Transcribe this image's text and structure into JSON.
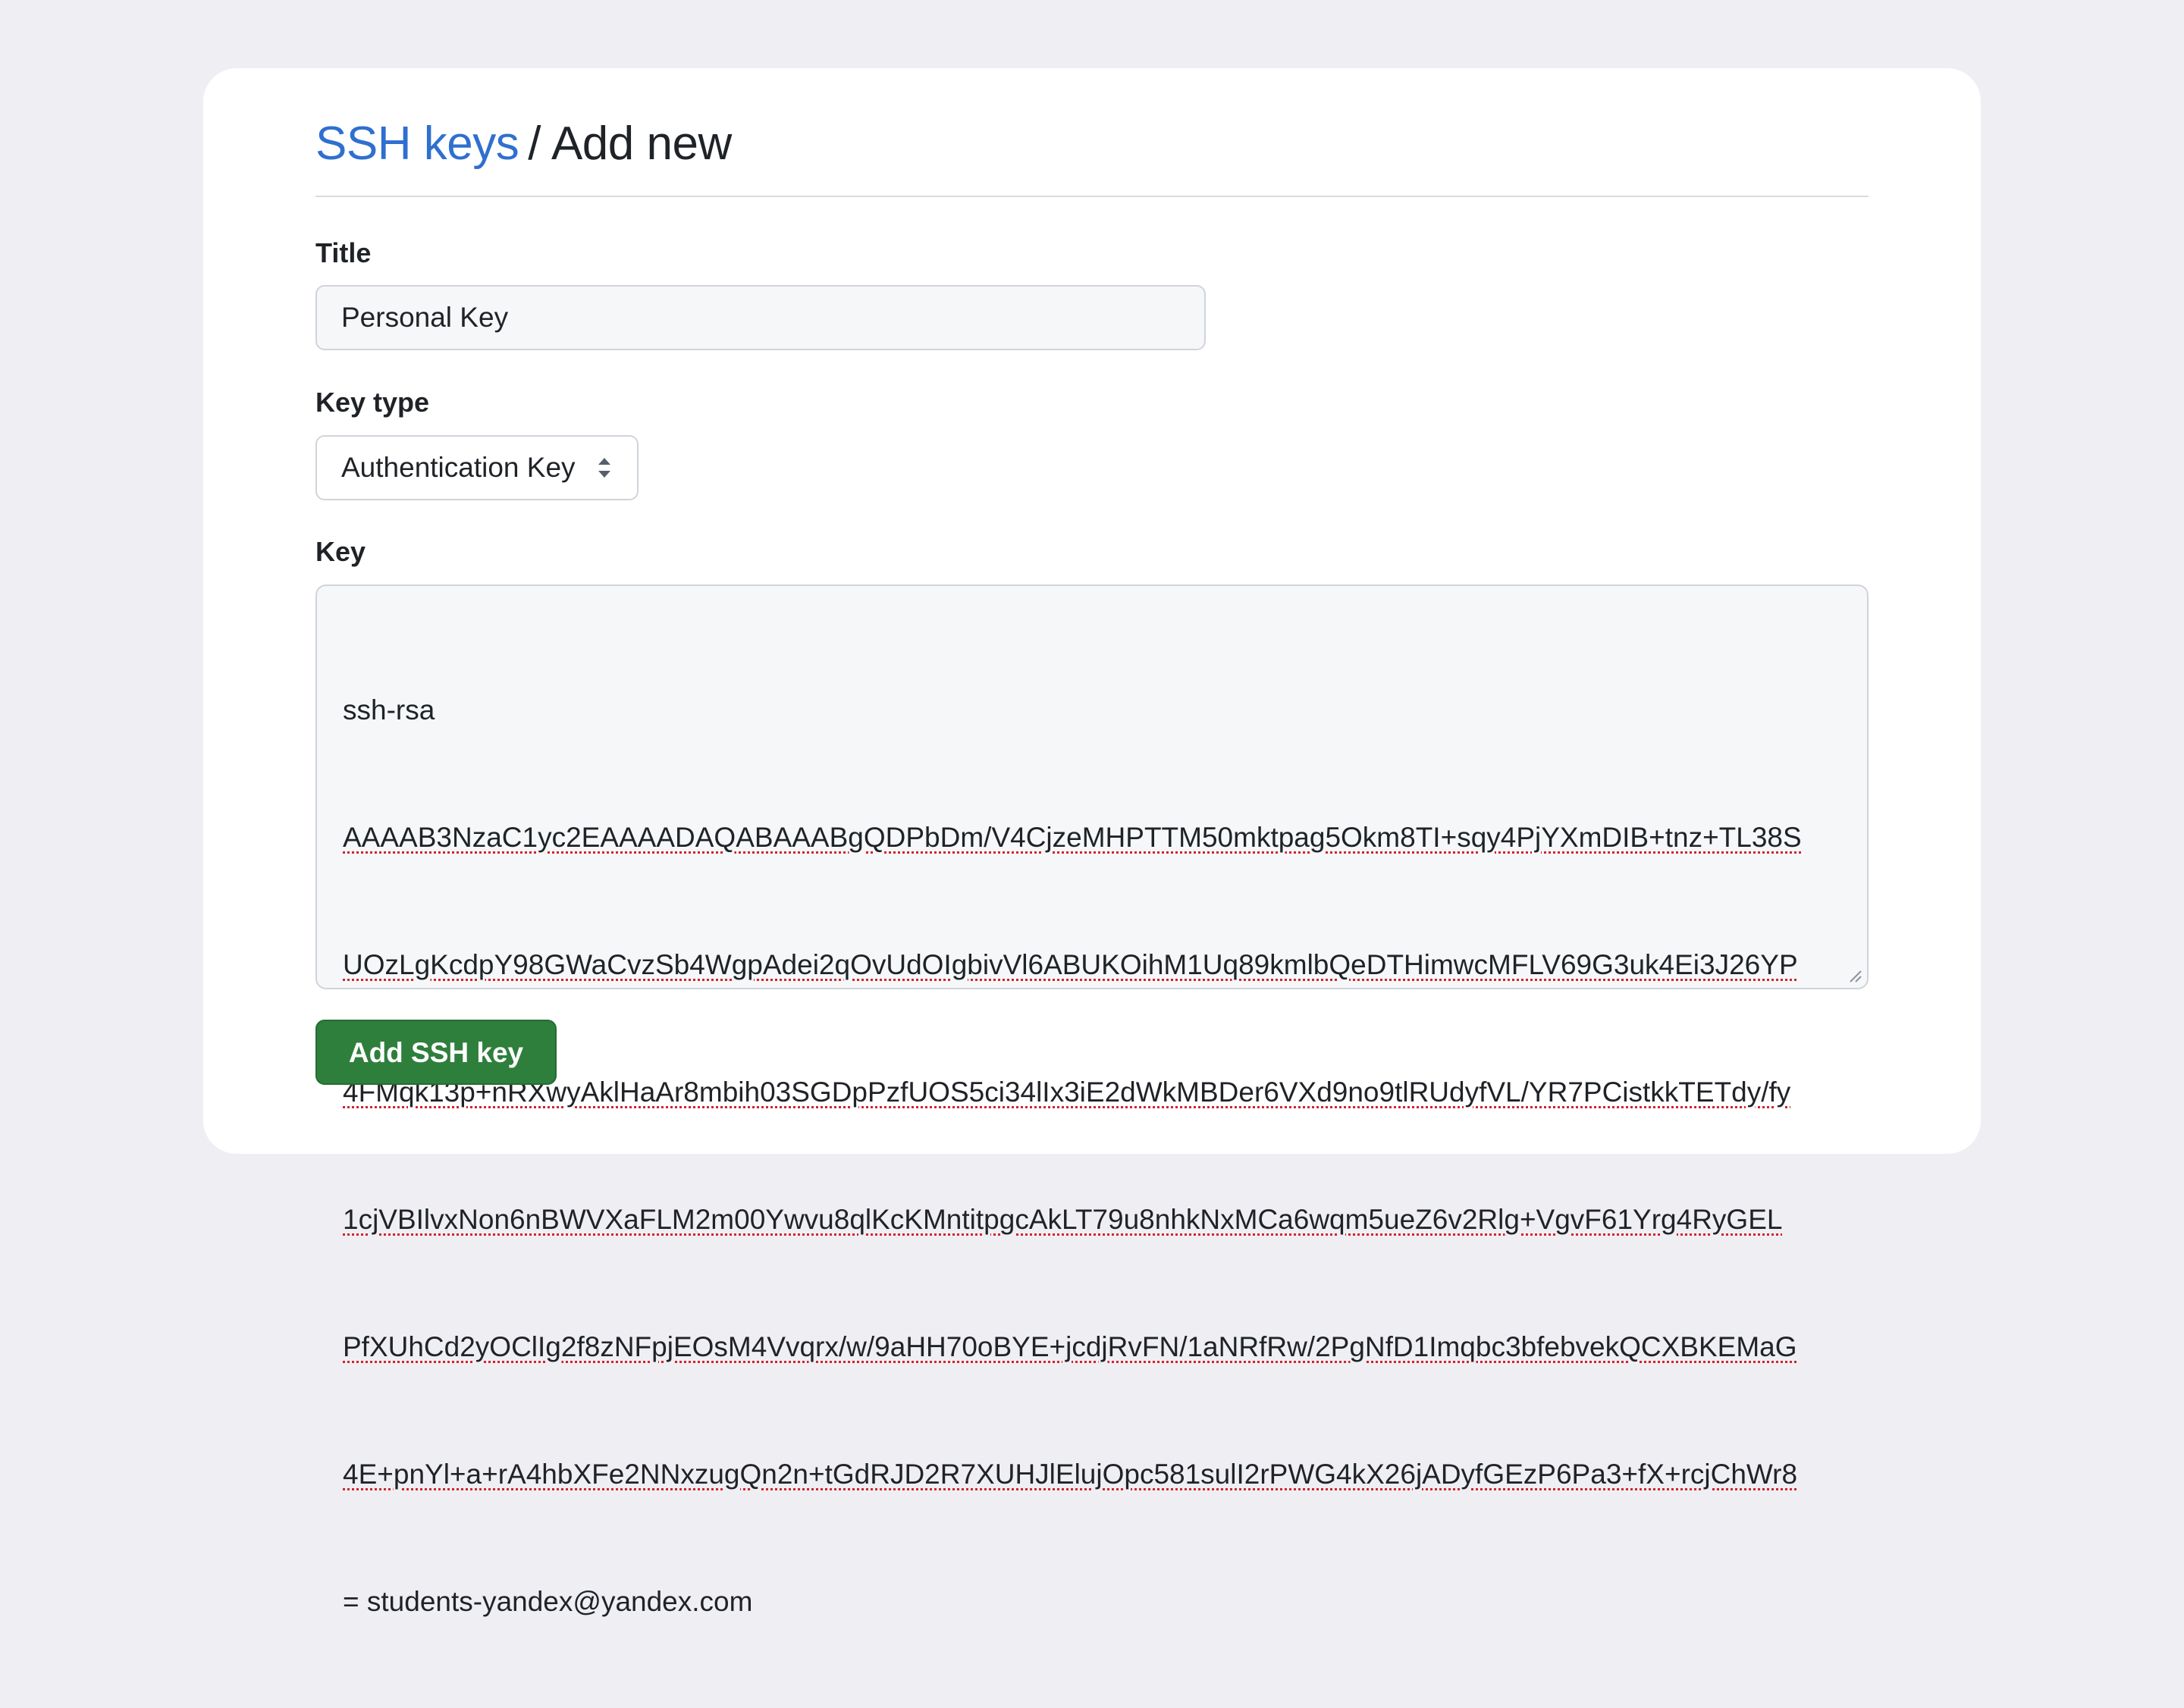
{
  "breadcrumb": {
    "parent_label": "SSH keys",
    "separator": "/",
    "current_label": "Add new"
  },
  "form": {
    "title_label": "Title",
    "title_value": "Personal Key",
    "key_type_label": "Key type",
    "key_type_value": "Authentication Key",
    "key_label": "Key",
    "key_lines": [
      "ssh-rsa",
      "AAAAB3NzaC1yc2EAAAADAQABAAABgQDPbDm/V4CjzeMHPTTM50mktpag5Okm8TI+sqy4PjYXmDIB+tnz+TL38S",
      "UOzLgKcdpY98GWaCvzSb4WgpAdei2qOvUdOIgbivVl6ABUKOihM1Uq89kmlbQeDTHimwcMFLV69G3uk4Ei3J26YP",
      "4FMqk13p+nRXwyAklHaAr8mbih03SGDpPzfUOS5ci34lIx3iE2dWkMBDer6VXd9no9tlRUdyfVL/YR7PCistkkTETdy/fy",
      "1cjVBIlvxNon6nBWVXaFLM2m00Ywvu8qlKcKMntitpgcAkLT79u8nhkNxMCa6wqm5ueZ6v2Rlg+VgvF61Yrg4RyGEL",
      "PfXUhCd2yOClIg2f8zNFpjEOsM4Vvqrx/w/9aHH70oBYE+jcdjRvFN/1aNRfRw/2PgNfD1Imqbc3bfebvekQCXBKEMaG",
      "4E+pnYl+a+rA4hbXFe2NNxzugQn2n+tGdRJD2R7XUHJlElujOpc581sulI2rPWG4kX26jADyfGEzP6Pa3+fX+rcjChWr8",
      "= students-yandex@yandex.com"
    ],
    "submit_label": "Add SSH key"
  },
  "colors": {
    "link": "#2f6fcf",
    "primary_button": "#2f7f3c",
    "page_background": "#efeff3",
    "spellcheck_underline": "#d1242f"
  },
  "icons": {
    "select_caret": "chevron-up-down-icon",
    "textarea_resize": "resize-handle-icon"
  }
}
